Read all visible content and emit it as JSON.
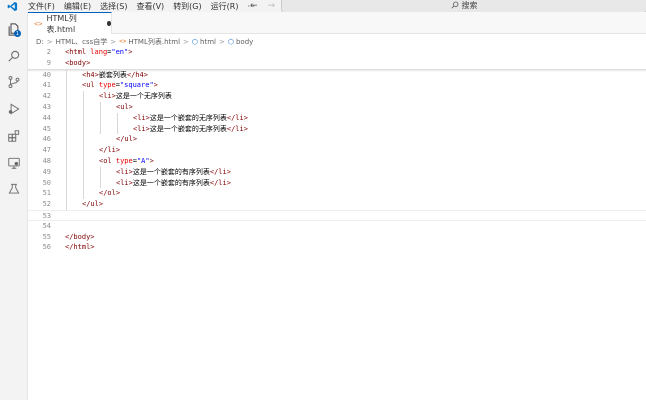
{
  "menu": [
    "文件(F)",
    "编辑(E)",
    "选择(S)",
    "查看(V)",
    "转到(G)",
    "运行(R)",
    "···"
  ],
  "nav": {
    "back": "←",
    "forward": "→"
  },
  "search": {
    "placeholder": "搜索"
  },
  "tab": {
    "icon": "<>",
    "label": "HTML列表.html"
  },
  "breadcrumb": {
    "drive": "D:",
    "folder": "HTML、css自学",
    "file_icon": "<>",
    "file": "HTML列表.html",
    "element1": "html",
    "element2": "body",
    "sep": ">"
  },
  "editor": {
    "sticky_lines": [
      {
        "n": "2",
        "parts": [
          {
            "t": "<html ",
            "c": "tag"
          },
          {
            "t": "lang",
            "c": "attr"
          },
          {
            "t": "=",
            "c": "txt"
          },
          {
            "t": "\"en\"",
            "c": "val"
          },
          {
            "t": ">",
            "c": "tag"
          }
        ]
      },
      {
        "n": "9",
        "parts": [
          {
            "t": "<body>",
            "c": "tag"
          }
        ]
      }
    ],
    "lines": [
      {
        "n": "40",
        "indent": 1,
        "parts": [
          {
            "t": "<h4>",
            "c": "tag"
          },
          {
            "t": "嵌套列表",
            "c": "txt"
          },
          {
            "t": "</h4>",
            "c": "tag"
          }
        ]
      },
      {
        "n": "41",
        "indent": 1,
        "parts": [
          {
            "t": "<ul ",
            "c": "tag"
          },
          {
            "t": "type",
            "c": "attr"
          },
          {
            "t": "=",
            "c": "txt"
          },
          {
            "t": "\"square\"",
            "c": "val"
          },
          {
            "t": ">",
            "c": "tag"
          }
        ]
      },
      {
        "n": "42",
        "indent": 2,
        "parts": [
          {
            "t": "<li>",
            "c": "tag"
          },
          {
            "t": "这是一个无序列表",
            "c": "txt"
          }
        ]
      },
      {
        "n": "43",
        "indent": 3,
        "parts": [
          {
            "t": "<ul>",
            "c": "tag"
          }
        ]
      },
      {
        "n": "44",
        "indent": 4,
        "parts": [
          {
            "t": "<li>",
            "c": "tag"
          },
          {
            "t": "这是一个嵌套的无序列表",
            "c": "txt"
          },
          {
            "t": "</li>",
            "c": "tag"
          }
        ]
      },
      {
        "n": "45",
        "indent": 4,
        "parts": [
          {
            "t": "<li>",
            "c": "tag"
          },
          {
            "t": "这是一个嵌套的无序列表",
            "c": "txt"
          },
          {
            "t": "</li>",
            "c": "tag"
          }
        ]
      },
      {
        "n": "46",
        "indent": 3,
        "parts": [
          {
            "t": "</ul>",
            "c": "tag"
          }
        ]
      },
      {
        "n": "47",
        "indent": 2,
        "parts": [
          {
            "t": "</li>",
            "c": "tag"
          }
        ]
      },
      {
        "n": "48",
        "indent": 2,
        "parts": [
          {
            "t": "<ol ",
            "c": "tag"
          },
          {
            "t": "type",
            "c": "attr"
          },
          {
            "t": "=",
            "c": "txt"
          },
          {
            "t": "\"A\"",
            "c": "val"
          },
          {
            "t": ">",
            "c": "tag"
          }
        ]
      },
      {
        "n": "49",
        "indent": 3,
        "parts": [
          {
            "t": "<li>",
            "c": "tag"
          },
          {
            "t": "这是一个嵌套的有序列表",
            "c": "txt"
          },
          {
            "t": "</li>",
            "c": "tag"
          }
        ]
      },
      {
        "n": "50",
        "indent": 3,
        "parts": [
          {
            "t": "<li>",
            "c": "tag"
          },
          {
            "t": "这是一个嵌套的有序列表",
            "c": "txt"
          },
          {
            "t": "</li>",
            "c": "tag"
          }
        ]
      },
      {
        "n": "51",
        "indent": 2,
        "parts": [
          {
            "t": "</ol>",
            "c": "tag"
          }
        ]
      },
      {
        "n": "52",
        "indent": 1,
        "parts": [
          {
            "t": "</ul>",
            "c": "tag"
          }
        ]
      },
      {
        "n": "53",
        "indent": 0,
        "parts": []
      },
      {
        "n": "54",
        "indent": 0,
        "parts": []
      },
      {
        "n": "55",
        "indent": 0,
        "parts": [
          {
            "t": "</body>",
            "c": "tag"
          }
        ]
      },
      {
        "n": "56",
        "indent": 0,
        "parts": [
          {
            "t": "</html>",
            "c": "tag"
          }
        ]
      }
    ]
  },
  "activity_icons": [
    "explorer-icon",
    "search-icon",
    "source-control-icon",
    "run-debug-icon",
    "extensions-icon",
    "remote-explorer-icon",
    "testing-icon"
  ],
  "explorer_badge": "1",
  "colors": {
    "accent": "#005fb8",
    "tag": "#800000",
    "attribute": "#e50000",
    "value": "#0000ff"
  }
}
